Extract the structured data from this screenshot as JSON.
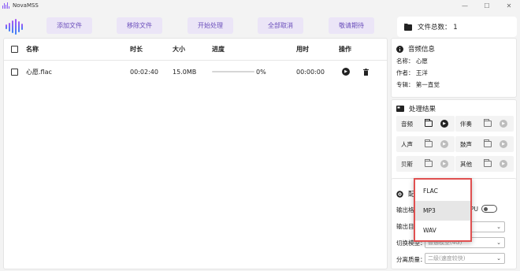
{
  "app": {
    "title": "NovaMSS"
  },
  "window": {
    "minimize": "—",
    "maximize": "☐",
    "close": "✕"
  },
  "toolbar": {
    "buttons": [
      "添加文件",
      "移除文件",
      "开始处理",
      "全部取消",
      "敬请期待"
    ],
    "file_count": "文件总数：  1"
  },
  "table": {
    "headers": [
      "名称",
      "时长",
      "大小",
      "进度",
      "用时",
      "操作"
    ],
    "rows": [
      {
        "name": "心愿.flac",
        "duration": "00:02:40",
        "size": "15.0MB",
        "progress": "0%",
        "progress_value": 0,
        "elapsed": "00:00:00"
      }
    ]
  },
  "audio_info": {
    "title": "音频信息",
    "name": "名称：  心愿",
    "artist": "作者：  王洋",
    "album": "专辑：  第一直觉"
  },
  "results": {
    "title": "处理结果",
    "items": [
      "音频",
      "伴奏",
      "人声",
      "鼓声",
      "贝斯",
      "其他"
    ]
  },
  "config": {
    "title": "配",
    "output_format_label": "输出格式",
    "gpu_label": "PU",
    "output_dir_label": "输出目",
    "model_label": "切换模型：",
    "model_value": "普通模型(4G)",
    "quality_label": "分离质量：",
    "quality_value": "二级(速度较快)"
  },
  "format_dropdown": {
    "options": [
      "FLAC",
      "MP3",
      "WAV"
    ],
    "selected": "MP3"
  },
  "colors": {
    "accent": "#6b4fbb",
    "button_bg": "#ebe5f7",
    "highlight": "#e05050"
  }
}
